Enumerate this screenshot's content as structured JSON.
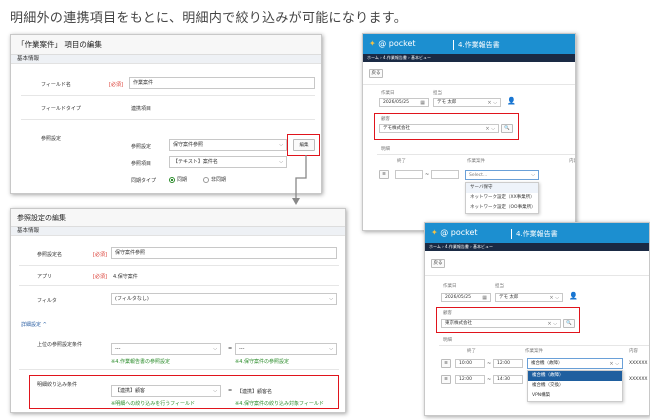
{
  "heading": "明細外の連携項目をもとに、明細内で絞り込みが可能になります。",
  "p1": {
    "title": "「作業案件」 項目の編集",
    "section": "基本情報",
    "field_name_label": "フィールド名",
    "req": "[必須]",
    "field_name_value": "作業案件",
    "field_type_label": "フィールドタイプ",
    "field_type_value": "連携項目",
    "ref_label": "参照設定",
    "ref_setting_label": "参照設定",
    "ref_setting_value": "保守案件参照",
    "ref_item_label": "参照項目",
    "ref_item_value": "【テキスト】案件名",
    "edit_button": "編集",
    "sync_label": "同期タイプ",
    "sync_on": "同期",
    "sync_off": "非同期"
  },
  "p2": {
    "title": "参照設定の編集",
    "section": "基本情報",
    "name_label": "参照設定名",
    "req": "[必須]",
    "name_value": "保守案件参照",
    "app_label": "アプリ",
    "app_value": "4.保守案件",
    "filter_label": "フィルタ",
    "filter_value": "(フィルタなし)",
    "detail_label": "詳細設定 ^",
    "upper_label": "上位の参照設定条件",
    "upper_left": "---",
    "upper_right": "---",
    "eq": "=",
    "upper_left_note": "※4.作業報告書の参照設定",
    "upper_right_note": "※4.保守案件の参照設定",
    "detail_cond_label": "明細絞り込み条件",
    "detail_cond_left": "【連携】顧客",
    "detail_cond_right": "【連携】顧客名",
    "detail_left_note": "※明細への絞り込みを行うフィールド",
    "detail_right_note": "※4.保守案件の絞り込み対象フィールド"
  },
  "p3": {
    "logo": "@ pocket",
    "app_title": "4.作業報告書",
    "nav": "ホーム  ›  4.作業報告書  ›  基本ビュー",
    "back": "戻る",
    "date_label": "作業日",
    "date_value": "2026/05/25",
    "staff_label": "担当",
    "staff_value": "デモ 太郎",
    "customer_label": "顧客",
    "customer_value": "デモ株式会社",
    "detail_label": "明細",
    "col_end": "終了",
    "col_case": "作業案件",
    "col_content": "内容",
    "select_placeholder": "Select...",
    "options": [
      "サーバ保守",
      "ネットワーク設定（XX事業所）",
      "ネットワーク設定（OO事業所）"
    ]
  },
  "p4": {
    "logo": "@ pocket",
    "app_title": "4.作業報告書",
    "nav": "ホーム  ›  4.作業報告書  ›  基本ビュー",
    "back": "戻る",
    "date_label": "作業日",
    "date_value": "2026/05/25",
    "staff_label": "担当",
    "staff_value": "デモ 太郎",
    "customer_label": "顧客",
    "customer_value": "東京株式会社",
    "detail_label": "明細",
    "col_end": "終了",
    "col_case": "作業案件",
    "col_content": "内容",
    "row1_start": "10:00",
    "row1_end": "12:00",
    "row1_case": "複合機（故障）",
    "row2_start": "12:00",
    "row2_end": "14:30",
    "row2_case": "複合機（故障）",
    "options": [
      "複合機（故障）",
      "複合機（交換）",
      "VPN構築"
    ],
    "content_prefix": "XXXXXX"
  }
}
